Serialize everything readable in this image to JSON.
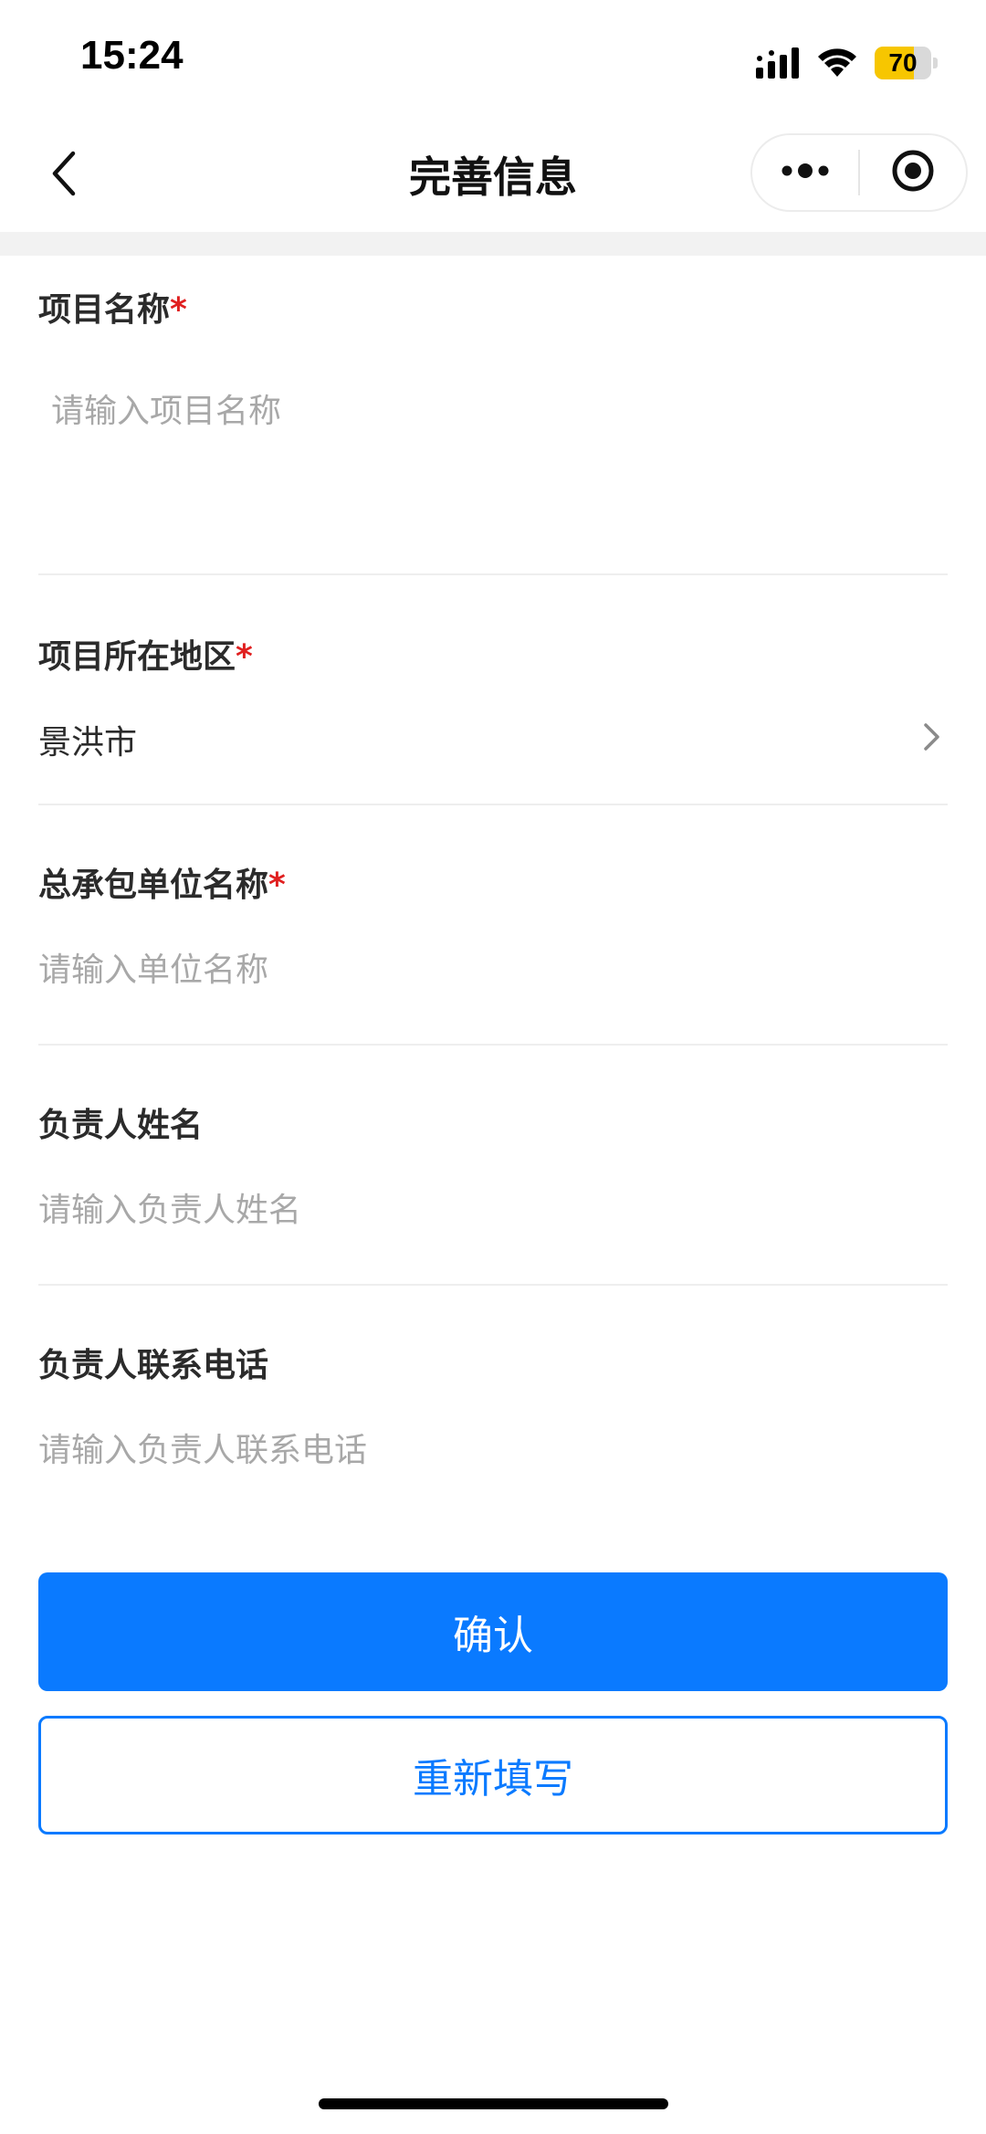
{
  "status_bar": {
    "time": "15:24",
    "battery_level": "70",
    "battery_color": "#f7c600",
    "icons": [
      "signal-icon",
      "wifi-icon",
      "battery-icon"
    ]
  },
  "nav": {
    "title": "完善信息",
    "back_icon": "chevron-left-icon",
    "more_icon": "more-dots-icon",
    "close_icon": "target-circle-icon"
  },
  "form": {
    "project_name": {
      "label": "项目名称",
      "required_mark": "*",
      "placeholder": "请输入项目名称"
    },
    "project_region": {
      "label": "项目所在地区",
      "required_mark": "*",
      "value": "景洪市",
      "icon": "chevron-right-icon"
    },
    "contractor_name": {
      "label": "总承包单位名称",
      "required_mark": "*",
      "placeholder": "请输入单位名称"
    },
    "manager_name": {
      "label": "负责人姓名",
      "placeholder": "请输入负责人姓名"
    },
    "manager_phone": {
      "label": "负责人联系电话",
      "placeholder": "请输入负责人联系电话"
    }
  },
  "actions": {
    "confirm_label": "确认",
    "reset_label": "重新填写",
    "primary_color": "#0a7aff"
  }
}
